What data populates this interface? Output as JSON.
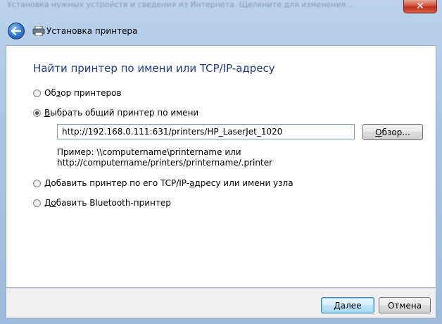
{
  "titlebar": {
    "blurred_text": "Установка нужных устройств и сведения из Интернета. Щелкните для изменения...",
    "close_glyph": "✕"
  },
  "window": {
    "title": "Установка принтера"
  },
  "main": {
    "heading": "Найти принтер по имени или TCP/IP-адресу",
    "options": [
      {
        "pre": "Об",
        "accel": "з",
        "post": "ор принтеров",
        "checked": false
      },
      {
        "pre": "",
        "accel": "В",
        "post": "ыбрать общий принтер по имени",
        "checked": true
      },
      {
        "pre": "Добавить принтер по его TCP/IP-",
        "accel": "а",
        "post": "дресу или имени узла",
        "checked": false
      },
      {
        "pre": "Д",
        "accel": "о",
        "post": "бавить Bluetooth-принтер",
        "checked": false
      }
    ],
    "printer_path_value": "http://192.168.0.111:631/printers/HP_LaserJet_1020",
    "browse_button": {
      "pre": "",
      "accel": "О",
      "post": "бзор..."
    },
    "hint_line1": "Пример: \\\\computername\\printername или",
    "hint_line2": "http://computername/printers/printername/.printer"
  },
  "footer": {
    "next_button": {
      "pre": "",
      "accel": "Д",
      "post": "алее"
    },
    "cancel_label": "Отмена"
  },
  "colors": {
    "heading": "#1e3c8e",
    "frame": "#a9c4e2"
  }
}
